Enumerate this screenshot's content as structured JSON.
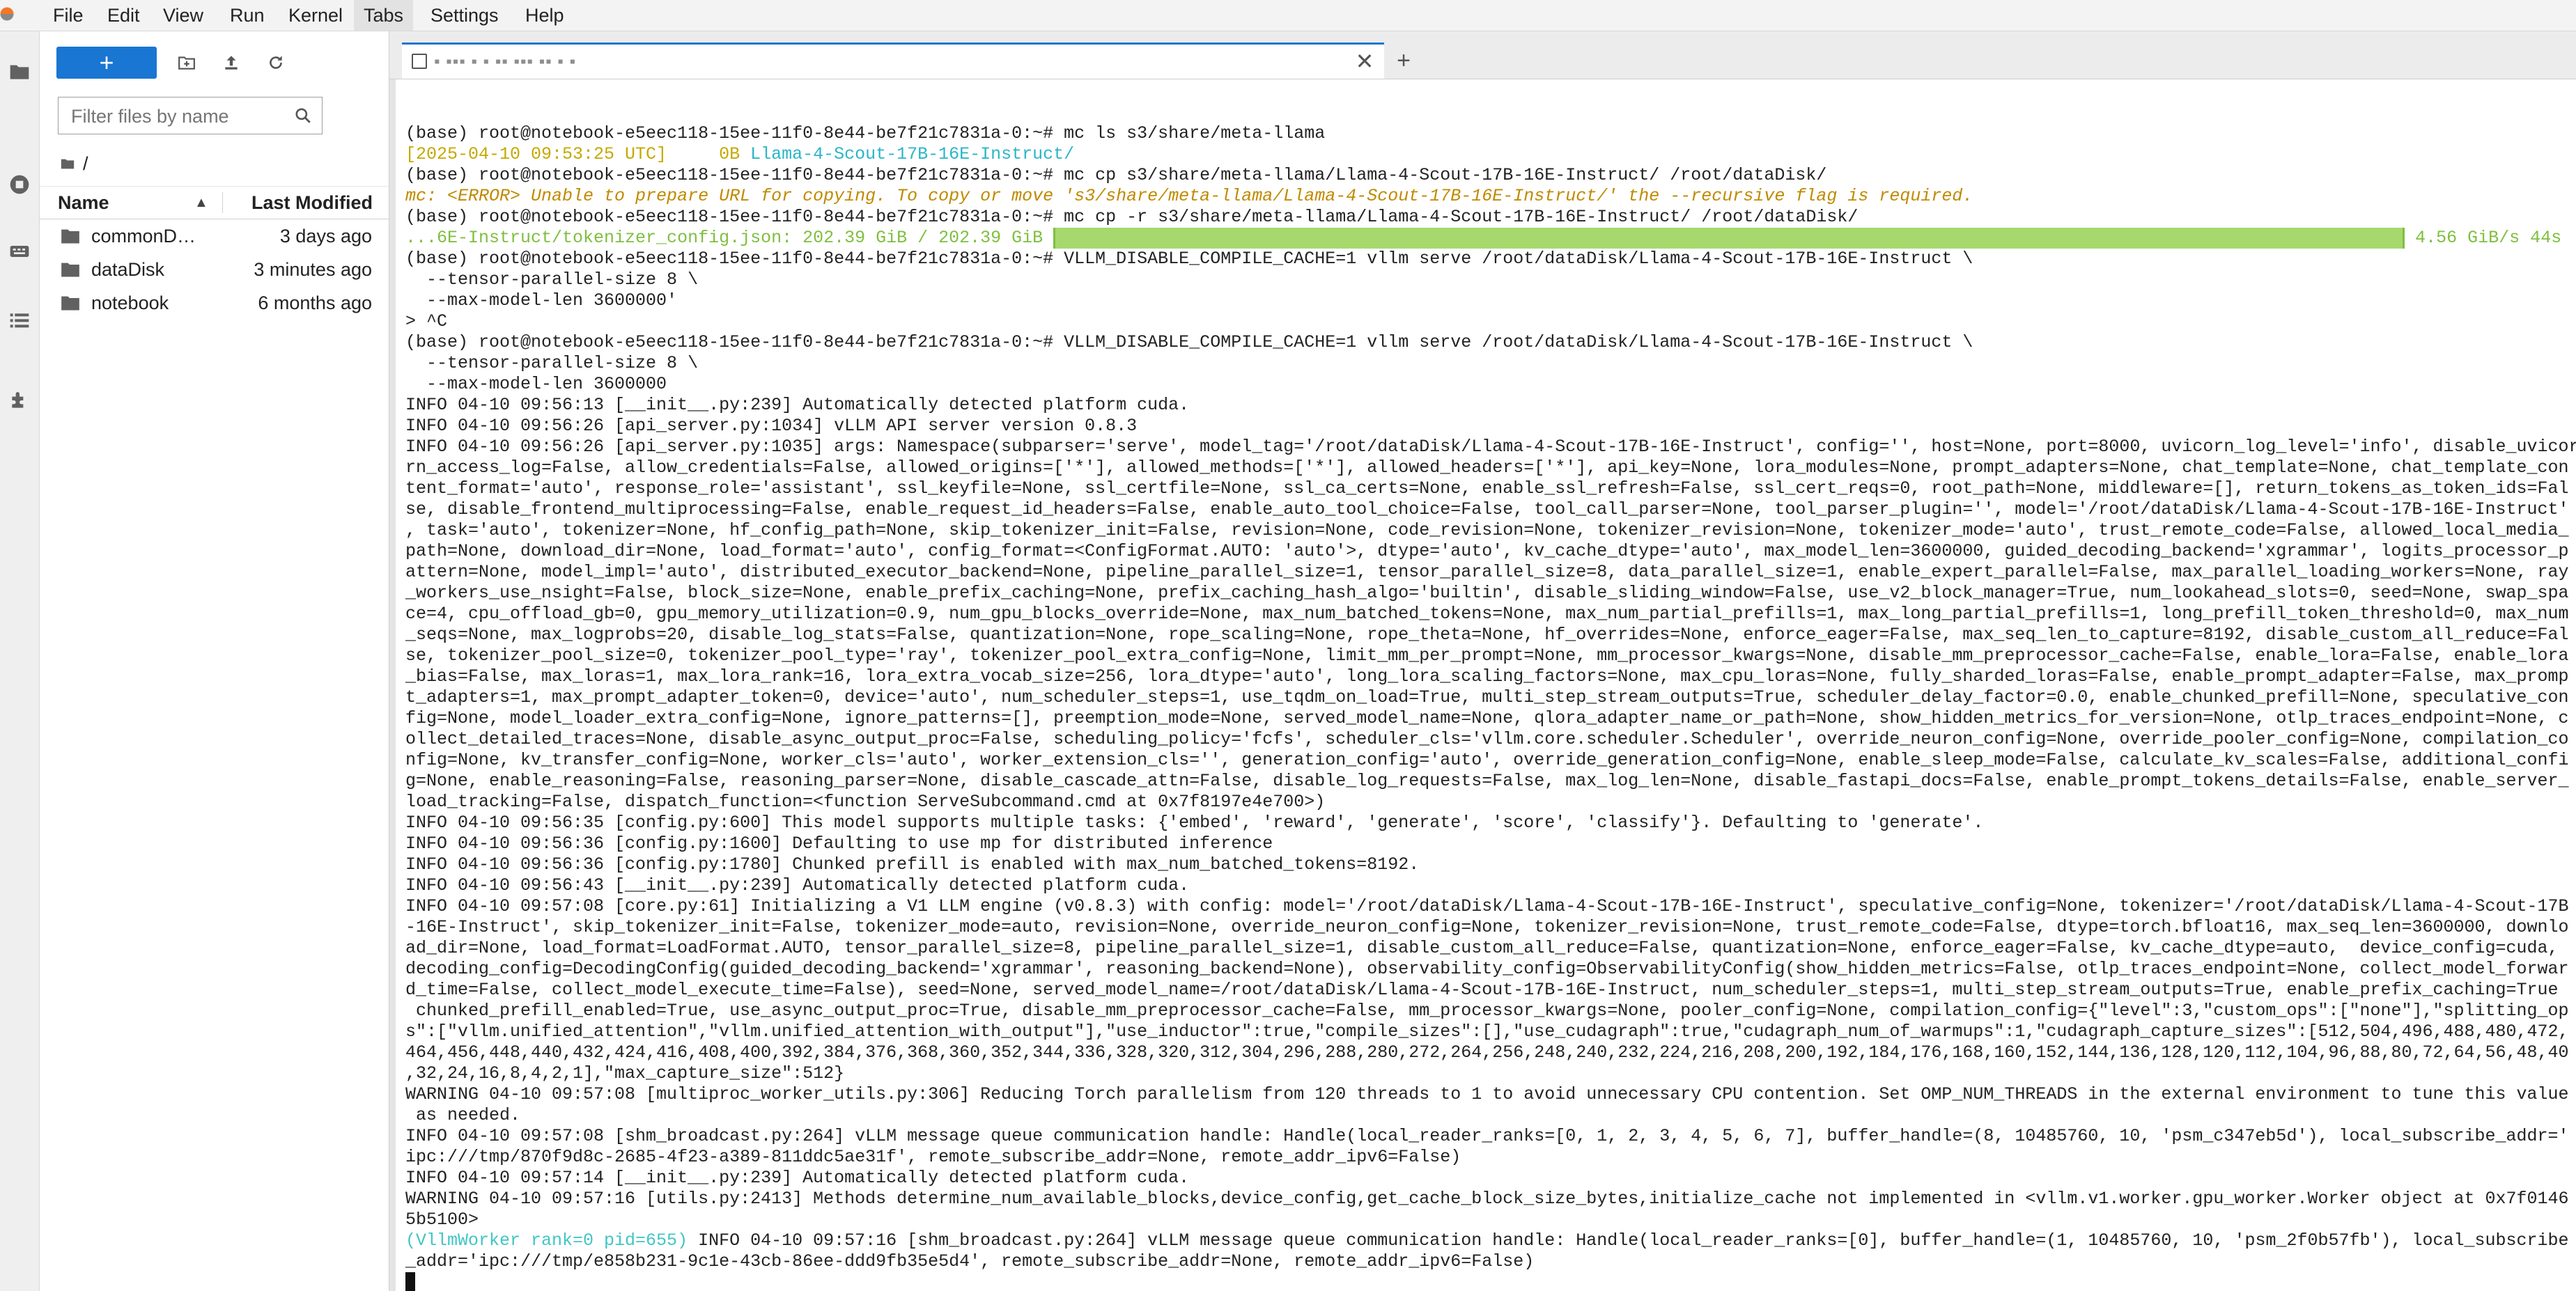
{
  "menu": {
    "items": [
      "File",
      "Edit",
      "View",
      "Run",
      "Kernel",
      "Tabs",
      "Settings",
      "Help"
    ],
    "active": "Tabs"
  },
  "colors": {
    "accent": "#1976d2",
    "terminal_yellow": "#c5a800",
    "terminal_cyan": "#2bb5c8",
    "terminal_green": "#7fbf3f",
    "folder": "#616161"
  },
  "activitybar": {
    "icons": [
      "folder-icon",
      "running-icon",
      "commands-icon",
      "toc-icon",
      "extension-icon"
    ]
  },
  "filebrowser": {
    "new_label": "+",
    "search_placeholder": "Filter files by name",
    "breadcrumb_root": "/",
    "col_name": "Name",
    "col_modified": "Last Modified",
    "sort_indicator": "▲",
    "rows": [
      {
        "name": "commonD…",
        "modified": "3 days ago"
      },
      {
        "name": "dataDisk",
        "modified": "3 minutes ago"
      },
      {
        "name": "notebook",
        "modified": "6 months ago"
      }
    ]
  },
  "tabs": {
    "terminal_tab_label": "▪ ▪▪▪  ▪  ▪  ▪▪   ▪▪▪  ▪▪  ▪  ▪",
    "close_glyph": "✕",
    "add_glyph": "+"
  },
  "terminal": {
    "lines": [
      {
        "text": "(base) root@notebook-e5eec118-15ee-11f0-8e44-be7f21c7831a-0:~# mc ls s3/share/meta-llama"
      },
      {
        "parts": [
          {
            "t": "[2025-04-10 09:53:25 UTC]     0B ",
            "c": "c-yellow"
          },
          {
            "t": "Llama-4-Scout-17B-16E-Instruct/",
            "c": "c-cyan"
          }
        ]
      },
      {
        "text": "(base) root@notebook-e5eec118-15ee-11f0-8e44-be7f21c7831a-0:~# mc cp s3/share/meta-llama/Llama-4-Scout-17B-16E-Instruct/ /root/dataDisk/"
      },
      {
        "parts": [
          {
            "t": "mc: <ERROR> Unable to prepare URL for copying. To copy or move 's3/share/meta-llama/Llama-4-Scout-17B-16E-Instruct/' the --recursive flag is required.",
            "c": "c-orange"
          }
        ]
      },
      {
        "text": "(base) root@notebook-e5eec118-15ee-11f0-8e44-be7f21c7831a-0:~# mc cp -r s3/share/meta-llama/Llama-4-Scout-17B-16E-Instruct/ /root/dataDisk/"
      },
      {
        "progress": true,
        "left": "...6E-Instruct/tokenizer_config.json: 202.39 GiB / 202.39 GiB ",
        "right": " 4.56 GiB/s 44s",
        "fill": 1.0
      },
      {
        "text": "(base) root@notebook-e5eec118-15ee-11f0-8e44-be7f21c7831a-0:~# VLLM_DISABLE_COMPILE_CACHE=1 vllm serve /root/dataDisk/Llama-4-Scout-17B-16E-Instruct \\"
      },
      {
        "text": "  --tensor-parallel-size 8 \\"
      },
      {
        "text": "  --max-model-len 3600000'"
      },
      {
        "text": "> ^C"
      },
      {
        "text": "(base) root@notebook-e5eec118-15ee-11f0-8e44-be7f21c7831a-0:~# VLLM_DISABLE_COMPILE_CACHE=1 vllm serve /root/dataDisk/Llama-4-Scout-17B-16E-Instruct \\"
      },
      {
        "text": "  --tensor-parallel-size 8 \\"
      },
      {
        "text": "  --max-model-len 3600000"
      },
      {
        "text": "INFO 04-10 09:56:13 [__init__.py:239] Automatically detected platform cuda."
      },
      {
        "text": "INFO 04-10 09:56:26 [api_server.py:1034] vLLM API server version 0.8.3"
      },
      {
        "text": "INFO 04-10 09:56:26 [api_server.py:1035] args: Namespace(subparser='serve', model_tag='/root/dataDisk/Llama-4-Scout-17B-16E-Instruct', config='', host=None, port=8000, uvicorn_log_level='info', disable_uvicorn"
      },
      {
        "text": "rn_access_log=False, allow_credentials=False, allowed_origins=['*'], allowed_methods=['*'], allowed_headers=['*'], api_key=None, lora_modules=None, prompt_adapters=None, chat_template=None, chat_template_con"
      },
      {
        "text": "tent_format='auto', response_role='assistant', ssl_keyfile=None, ssl_certfile=None, ssl_ca_certs=None, enable_ssl_refresh=False, ssl_cert_reqs=0, root_path=None, middleware=[], return_tokens_as_token_ids=Fal"
      },
      {
        "text": "se, disable_frontend_multiprocessing=False, enable_request_id_headers=False, enable_auto_tool_choice=False, tool_call_parser=None, tool_parser_plugin='', model='/root/dataDisk/Llama-4-Scout-17B-16E-Instruct'"
      },
      {
        "text": ", task='auto', tokenizer=None, hf_config_path=None, skip_tokenizer_init=False, revision=None, code_revision=None, tokenizer_revision=None, tokenizer_mode='auto', trust_remote_code=False, allowed_local_media_"
      },
      {
        "text": "path=None, download_dir=None, load_format='auto', config_format=<ConfigFormat.AUTO: 'auto'>, dtype='auto', kv_cache_dtype='auto', max_model_len=3600000, guided_decoding_backend='xgrammar', logits_processor_p"
      },
      {
        "text": "attern=None, model_impl='auto', distributed_executor_backend=None, pipeline_parallel_size=1, tensor_parallel_size=8, data_parallel_size=1, enable_expert_parallel=False, max_parallel_loading_workers=None, ray"
      },
      {
        "text": "_workers_use_nsight=False, block_size=None, enable_prefix_caching=None, prefix_caching_hash_algo='builtin', disable_sliding_window=False, use_v2_block_manager=True, num_lookahead_slots=0, seed=None, swap_spa"
      },
      {
        "text": "ce=4, cpu_offload_gb=0, gpu_memory_utilization=0.9, num_gpu_blocks_override=None, max_num_batched_tokens=None, max_num_partial_prefills=1, max_long_partial_prefills=1, long_prefill_token_threshold=0, max_num"
      },
      {
        "text": "_seqs=None, max_logprobs=20, disable_log_stats=False, quantization=None, rope_scaling=None, rope_theta=None, hf_overrides=None, enforce_eager=False, max_seq_len_to_capture=8192, disable_custom_all_reduce=Fal"
      },
      {
        "text": "se, tokenizer_pool_size=0, tokenizer_pool_type='ray', tokenizer_pool_extra_config=None, limit_mm_per_prompt=None, mm_processor_kwargs=None, disable_mm_preprocessor_cache=False, enable_lora=False, enable_lora"
      },
      {
        "text": "_bias=False, max_loras=1, max_lora_rank=16, lora_extra_vocab_size=256, lora_dtype='auto', long_lora_scaling_factors=None, max_cpu_loras=None, fully_sharded_loras=False, enable_prompt_adapter=False, max_promp"
      },
      {
        "text": "t_adapters=1, max_prompt_adapter_token=0, device='auto', num_scheduler_steps=1, use_tqdm_on_load=True, multi_step_stream_outputs=True, scheduler_delay_factor=0.0, enable_chunked_prefill=None, speculative_con"
      },
      {
        "text": "fig=None, model_loader_extra_config=None, ignore_patterns=[], preemption_mode=None, served_model_name=None, qlora_adapter_name_or_path=None, show_hidden_metrics_for_version=None, otlp_traces_endpoint=None, c"
      },
      {
        "text": "ollect_detailed_traces=None, disable_async_output_proc=False, scheduling_policy='fcfs', scheduler_cls='vllm.core.scheduler.Scheduler', override_neuron_config=None, override_pooler_config=None, compilation_co"
      },
      {
        "text": "nfig=None, kv_transfer_config=None, worker_cls='auto', worker_extension_cls='', generation_config='auto', override_generation_config=None, enable_sleep_mode=False, calculate_kv_scales=False, additional_confi"
      },
      {
        "text": "g=None, enable_reasoning=False, reasoning_parser=None, disable_cascade_attn=False, disable_log_requests=False, max_log_len=None, disable_fastapi_docs=False, enable_prompt_tokens_details=False, enable_server_"
      },
      {
        "text": "load_tracking=False, dispatch_function=<function ServeSubcommand.cmd at 0x7f8197e4e700>)"
      },
      {
        "text": "INFO 04-10 09:56:35 [config.py:600] This model supports multiple tasks: {'embed', 'reward', 'generate', 'score', 'classify'}. Defaulting to 'generate'."
      },
      {
        "text": "INFO 04-10 09:56:36 [config.py:1600] Defaulting to use mp for distributed inference"
      },
      {
        "text": "INFO 04-10 09:56:36 [config.py:1780] Chunked prefill is enabled with max_num_batched_tokens=8192."
      },
      {
        "text": "INFO 04-10 09:56:43 [__init__.py:239] Automatically detected platform cuda."
      },
      {
        "text": "INFO 04-10 09:57:08 [core.py:61] Initializing a V1 LLM engine (v0.8.3) with config: model='/root/dataDisk/Llama-4-Scout-17B-16E-Instruct', speculative_config=None, tokenizer='/root/dataDisk/Llama-4-Scout-17B"
      },
      {
        "text": "-16E-Instruct', skip_tokenizer_init=False, tokenizer_mode=auto, revision=None, override_neuron_config=None, tokenizer_revision=None, trust_remote_code=False, dtype=torch.bfloat16, max_seq_len=3600000, downlo"
      },
      {
        "text": "ad_dir=None, load_format=LoadFormat.AUTO, tensor_parallel_size=8, pipeline_parallel_size=1, disable_custom_all_reduce=False, quantization=None, enforce_eager=False, kv_cache_dtype=auto,  device_config=cuda, "
      },
      {
        "text": "decoding_config=DecodingConfig(guided_decoding_backend='xgrammar', reasoning_backend=None), observability_config=ObservabilityConfig(show_hidden_metrics=False, otlp_traces_endpoint=None, collect_model_forwar"
      },
      {
        "text": "d_time=False, collect_model_execute_time=False), seed=None, served_model_name=/root/dataDisk/Llama-4-Scout-17B-16E-Instruct, num_scheduler_steps=1, multi_step_stream_outputs=True, enable_prefix_caching=True"
      },
      {
        "text": " chunked_prefill_enabled=True, use_async_output_proc=True, disable_mm_preprocessor_cache=False, mm_processor_kwargs=None, pooler_config=None, compilation_config={\"level\":3,\"custom_ops\":[\"none\"],\"splitting_op"
      },
      {
        "text": "s\":[\"vllm.unified_attention\",\"vllm.unified_attention_with_output\"],\"use_inductor\":true,\"compile_sizes\":[],\"use_cudagraph\":true,\"cudagraph_num_of_warmups\":1,\"cudagraph_capture_sizes\":[512,504,496,488,480,472,"
      },
      {
        "text": "464,456,448,440,432,424,416,408,400,392,384,376,368,360,352,344,336,328,320,312,304,296,288,280,272,264,256,248,240,232,224,216,208,200,192,184,176,168,160,152,144,136,128,120,112,104,96,88,80,72,64,56,48,40"
      },
      {
        "text": ",32,24,16,8,4,2,1],\"max_capture_size\":512}"
      },
      {
        "text": "WARNING 04-10 09:57:08 [multiproc_worker_utils.py:306] Reducing Torch parallelism from 120 threads to 1 to avoid unnecessary CPU contention. Set OMP_NUM_THREADS in the external environment to tune this value"
      },
      {
        "text": " as needed."
      },
      {
        "text": "INFO 04-10 09:57:08 [shm_broadcast.py:264] vLLM message queue communication handle: Handle(local_reader_ranks=[0, 1, 2, 3, 4, 5, 6, 7], buffer_handle=(8, 10485760, 10, 'psm_c347eb5d'), local_subscribe_addr='"
      },
      {
        "text": "ipc:///tmp/870f9d8c-2685-4f23-a389-811ddc5ae31f', remote_subscribe_addr=None, remote_addr_ipv6=False)"
      },
      {
        "text": "INFO 04-10 09:57:14 [__init__.py:239] Automatically detected platform cuda."
      },
      {
        "text": "WARNING 04-10 09:57:16 [utils.py:2413] Methods determine_num_available_blocks,device_config,get_cache_block_size_bytes,initialize_cache not implemented in <vllm.v1.worker.gpu_worker.Worker object at 0x7f0146"
      },
      {
        "text": "5b5100>"
      },
      {
        "parts": [
          {
            "t": "(VllmWorker rank=0 pid=655)",
            "c": "c-teal"
          },
          {
            "t": " INFO 04-10 09:57:16 [shm_broadcast.py:264] vLLM message queue communication handle: Handle(local_reader_ranks=[0], buffer_handle=(1, 10485760, 10, 'psm_2f0b57fb'), local_subscribe",
            "c": ""
          }
        ]
      },
      {
        "text": "_addr='ipc:///tmp/e858b231-9c1e-43cb-86ee-ddd9fb35e5d4', remote_subscribe_addr=None, remote_addr_ipv6=False)"
      },
      {
        "cursor": true
      }
    ]
  }
}
